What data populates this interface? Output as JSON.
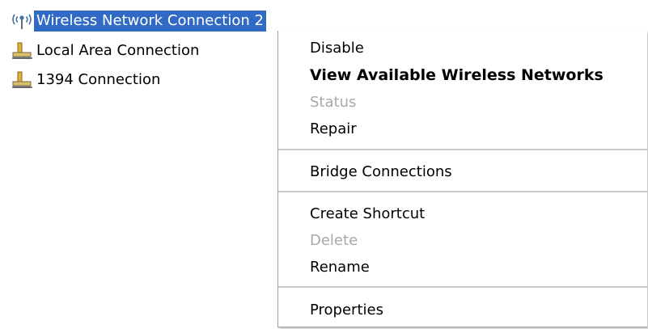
{
  "connections": [
    {
      "label": "Wireless Network Connection 2",
      "icon": "wireless-signal-icon",
      "selected": true
    },
    {
      "label": "Local Area Connection",
      "icon": "network-connection-icon",
      "selected": false
    },
    {
      "label": "1394 Connection",
      "icon": "network-connection-icon",
      "selected": false
    }
  ],
  "context_menu": {
    "items": [
      {
        "label": "Disable",
        "state": "normal"
      },
      {
        "label": "View Available Wireless Networks",
        "state": "default"
      },
      {
        "label": "Status",
        "state": "disabled"
      },
      {
        "label": "Repair",
        "state": "normal"
      },
      {
        "label": "Bridge Connections",
        "state": "normal"
      },
      {
        "label": "Create Shortcut",
        "state": "normal"
      },
      {
        "label": "Delete",
        "state": "disabled"
      },
      {
        "label": "Rename",
        "state": "normal"
      },
      {
        "label": "Properties",
        "state": "normal"
      }
    ]
  },
  "colors": {
    "selection": "#316ac5",
    "disabled_text": "#a8a8a8",
    "separator": "#c8c8c8"
  }
}
